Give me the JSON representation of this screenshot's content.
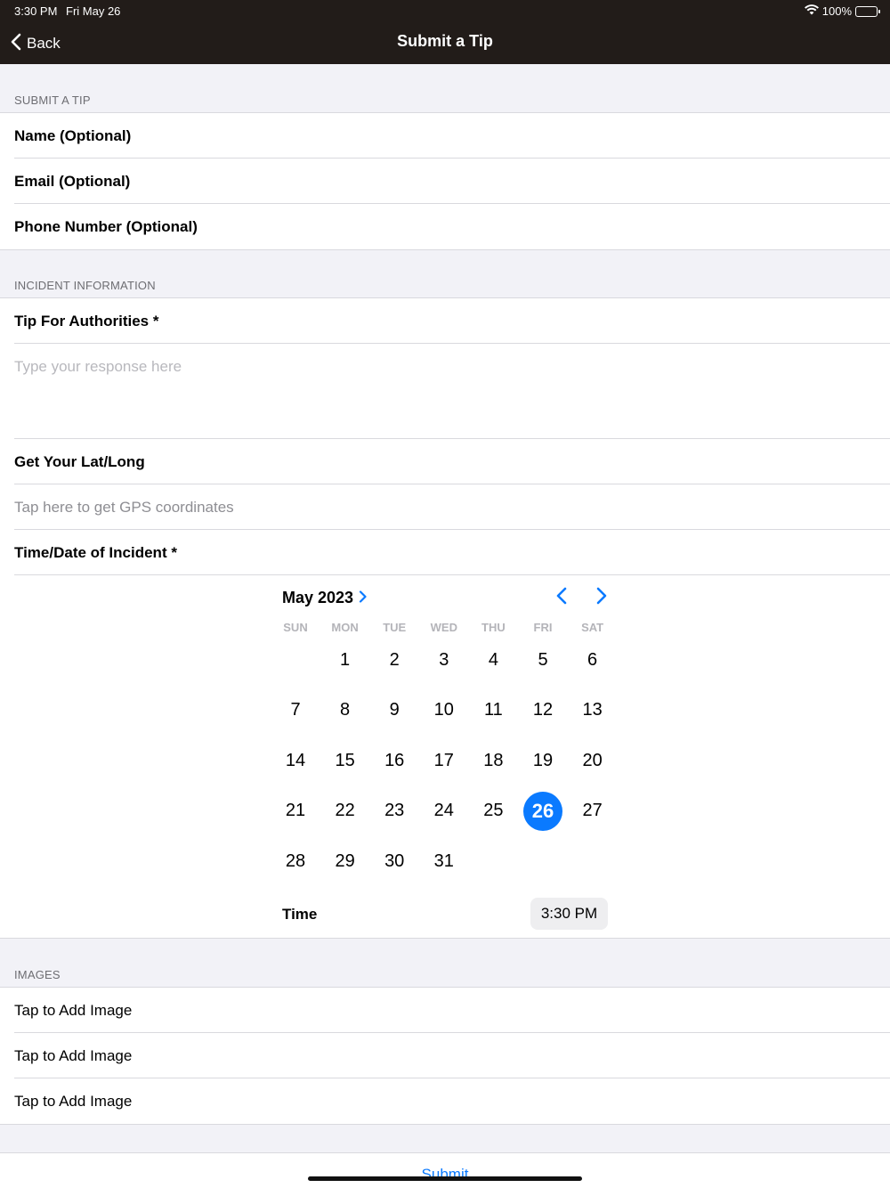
{
  "status_bar": {
    "time": "3:30 PM",
    "date": "Fri May 26",
    "battery": "100%"
  },
  "nav": {
    "back_label": "Back",
    "title": "Submit a Tip"
  },
  "submit_section": {
    "header": "SUBMIT A TIP",
    "fields": [
      "Name (Optional)",
      "Email (Optional)",
      "Phone Number (Optional)"
    ]
  },
  "incident_section": {
    "header": "INCIDENT INFORMATION",
    "tip_label": "Tip For Authorities *",
    "tip_placeholder": "Type your response here",
    "latlong_label": "Get Your Lat/Long",
    "gps_hint": "Tap here to get GPS coordinates",
    "datetime_label": "Time/Date of Incident *"
  },
  "calendar": {
    "month_label": "May 2023",
    "weekdays": [
      "SUN",
      "MON",
      "TUE",
      "WED",
      "THU",
      "FRI",
      "SAT"
    ],
    "first_weekday_index": 1,
    "days_in_month": 31,
    "selected_day": 26,
    "time_label": "Time",
    "time_value": "3:30 PM"
  },
  "images_section": {
    "header": "IMAGES",
    "items": [
      "Tap to Add Image",
      "Tap to Add Image",
      "Tap to Add Image"
    ]
  },
  "submit_label": "Submit",
  "colors": {
    "nav_bg": "#221c19",
    "accent": "#0a7aff",
    "background": "#f2f2f7"
  }
}
